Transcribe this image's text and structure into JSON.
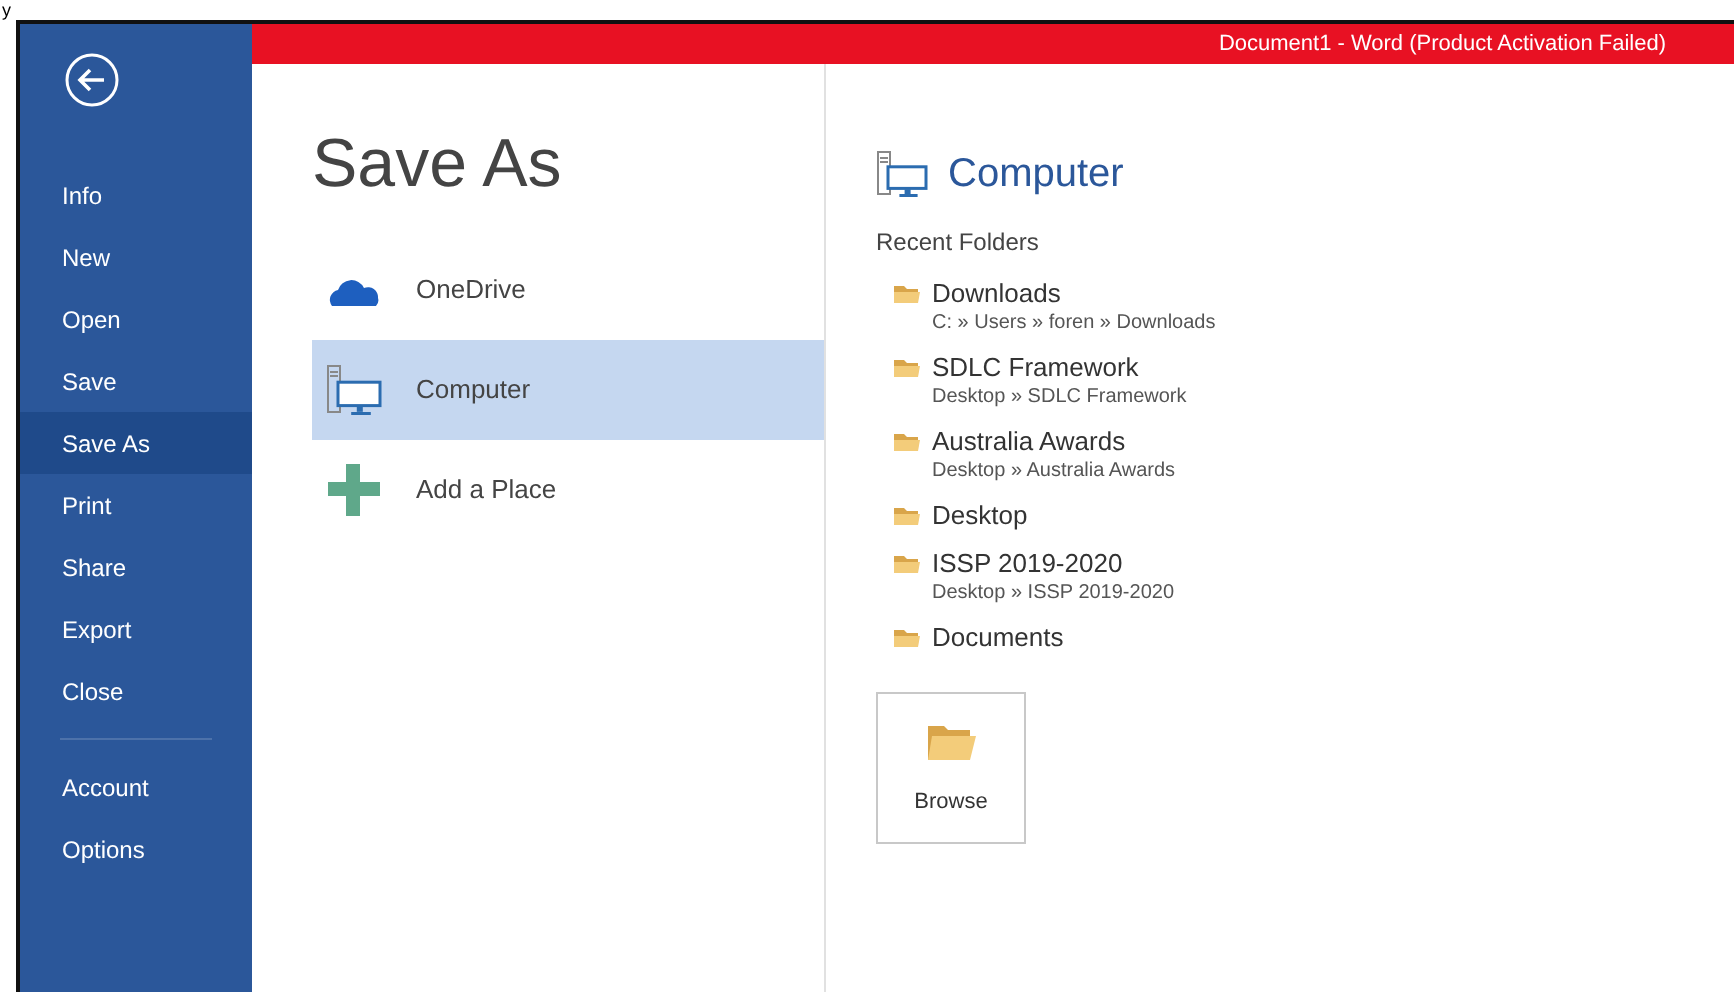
{
  "page_fragment": "y",
  "window": {
    "title": "Document1 -  Word (Product Activation Failed)"
  },
  "sidebar": {
    "items": [
      {
        "label": "Info",
        "selected": false
      },
      {
        "label": "New",
        "selected": false
      },
      {
        "label": "Open",
        "selected": false
      },
      {
        "label": "Save",
        "selected": false
      },
      {
        "label": "Save As",
        "selected": true
      },
      {
        "label": "Print",
        "selected": false
      },
      {
        "label": "Share",
        "selected": false
      },
      {
        "label": "Export",
        "selected": false
      },
      {
        "label": "Close",
        "selected": false
      }
    ],
    "bottom_items": [
      {
        "label": "Account",
        "selected": false
      },
      {
        "label": "Options",
        "selected": false
      }
    ]
  },
  "heading": "Save As",
  "places": [
    {
      "kind": "cloud",
      "label": "OneDrive",
      "selected": false
    },
    {
      "kind": "computer",
      "label": "Computer",
      "selected": true
    },
    {
      "kind": "add",
      "label": "Add a Place",
      "selected": false
    }
  ],
  "detail": {
    "title": "Computer",
    "section": "Recent Folders",
    "folders": [
      {
        "name": "Downloads",
        "path": "C: » Users » foren » Downloads"
      },
      {
        "name": "SDLC Framework",
        "path": "Desktop » SDLC Framework"
      },
      {
        "name": "Australia Awards",
        "path": "Desktop » Australia Awards"
      },
      {
        "name": "Desktop"
      },
      {
        "name": "ISSP 2019-2020",
        "path": "Desktop » ISSP 2019-2020"
      },
      {
        "name": "Documents"
      }
    ],
    "browse": "Browse"
  }
}
